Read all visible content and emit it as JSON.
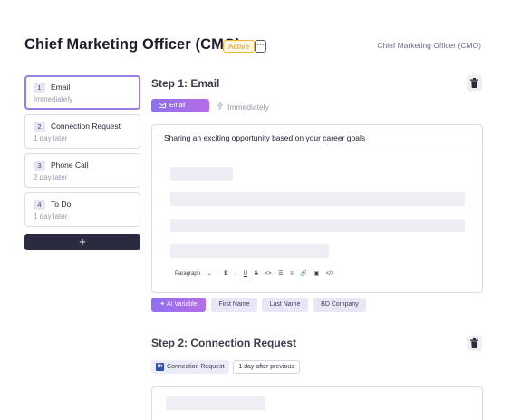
{
  "header": {
    "title": "Chief Marketing Officer (CMO)",
    "status": "Active",
    "more": "···",
    "breadcrumb": "Chief Marketing Officer (CMO)"
  },
  "steps": [
    {
      "num": "1",
      "label": "Email",
      "sub": "Immediately"
    },
    {
      "num": "2",
      "label": "Connection Request",
      "sub": "1 day later"
    },
    {
      "num": "3",
      "label": "Phone Call",
      "sub": "2 day later"
    },
    {
      "num": "4",
      "label": "To Do",
      "sub": "1 day later"
    }
  ],
  "add_step": "+",
  "step1": {
    "title": "Step 1: Email",
    "channel": "Email",
    "timing": "Immediately",
    "subject": "Sharing an exciting opportunity based on your career goals",
    "toolbar": {
      "paragraph": "Paragraph",
      "dropdown": "⌄",
      "bold": "B",
      "italic": "I",
      "underline": "U",
      "strike": "S",
      "code": "<>",
      "bullets": "☰",
      "numbered": "≡",
      "link": "🔗",
      "image": "▣",
      "source": "</>"
    },
    "variables": [
      "AI Variable",
      "First Name",
      "Last Name",
      "BD Company"
    ]
  },
  "step2": {
    "title": "Step 2: Connection Request",
    "channel": "Connection Request",
    "channel_icon": "in",
    "delay": "1 day after previous"
  },
  "colors": {
    "accent": "#9a7ee8",
    "status": "#f0b43c",
    "dark": "#2b2b3f"
  }
}
